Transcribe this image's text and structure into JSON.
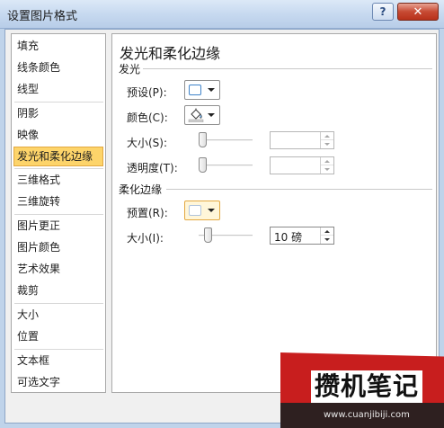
{
  "window": {
    "title": "设置图片格式",
    "help_label": "?",
    "close_label": "✕"
  },
  "colors": {
    "accent_selected": "#fdd46a",
    "swatch_border": "#3f83c9",
    "watermark_red": "#c81e1e"
  },
  "nav": {
    "items": [
      {
        "label": "填充"
      },
      {
        "label": "线条颜色"
      },
      {
        "label": "线型"
      },
      {
        "label": "阴影"
      },
      {
        "label": "映像"
      },
      {
        "label": "发光和柔化边缘",
        "selected": true
      },
      {
        "label": "三维格式"
      },
      {
        "label": "三维旋转"
      },
      {
        "label": "图片更正"
      },
      {
        "label": "图片颜色"
      },
      {
        "label": "艺术效果"
      },
      {
        "label": "裁剪"
      },
      {
        "label": "大小"
      },
      {
        "label": "位置"
      },
      {
        "label": "文本框"
      },
      {
        "label": "可选文字"
      }
    ]
  },
  "panel": {
    "title": "发光和柔化边缘",
    "glow": {
      "header": "发光",
      "preset_label": "预设(P):",
      "color_label": "颜色(C):",
      "size_label": "大小(S):",
      "transparency_label": "透明度(T):",
      "size_value": "",
      "transparency_value": ""
    },
    "soft_edges": {
      "header": "柔化边缘",
      "preset_label": "预置(R):",
      "size_label": "大小(I):",
      "size_value": "10 磅"
    }
  },
  "watermark": {
    "brand": "攒机笔记",
    "url": "www.cuanjibiji.com"
  }
}
